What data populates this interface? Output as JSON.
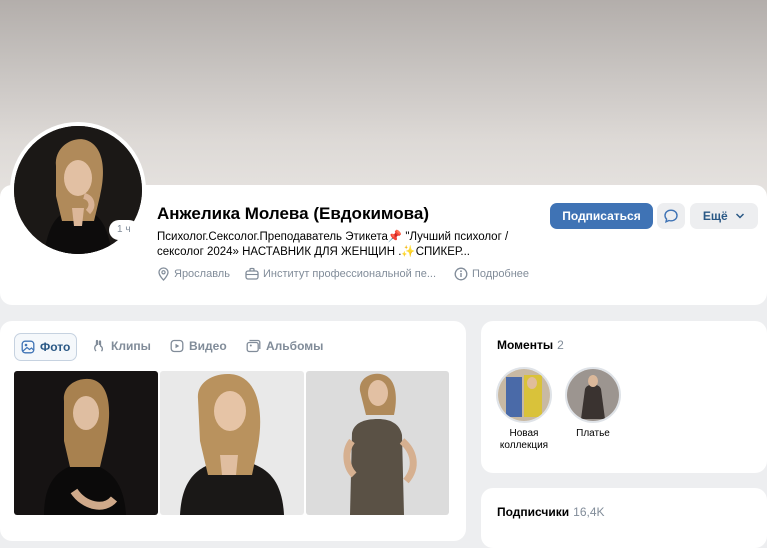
{
  "profile": {
    "name": "Анжелика Молева (Евдокимова)",
    "time_badge": "1 ч",
    "status_line1": "Психолог.Сексолог.Преподаватель Этикета📌 \"Лучший психолог /",
    "status_line2": "сексолог 2024» НАСТАВНИК ДЛЯ ЖЕНЩИН .✨СПИКЕР...",
    "city": "Ярославль",
    "work": "Институт профессиональной пе...",
    "more_info": "Подробнее"
  },
  "actions": {
    "subscribe": "Подписаться",
    "more": "Ещё"
  },
  "photos": {
    "tabs": [
      {
        "label": "Фото"
      },
      {
        "label": "Клипы"
      },
      {
        "label": "Видео"
      },
      {
        "label": "Альбомы"
      }
    ]
  },
  "moments": {
    "title": "Моменты",
    "count": "2",
    "items": [
      {
        "label": "Новая коллекция"
      },
      {
        "label": "Платье"
      }
    ]
  },
  "subscribers": {
    "title": "Подписчики",
    "count": "16,4K"
  },
  "colors": {
    "accent": "#3f73b5",
    "link": "#2a5885",
    "secondary_text": "#818c99",
    "background": "#edeef0"
  }
}
